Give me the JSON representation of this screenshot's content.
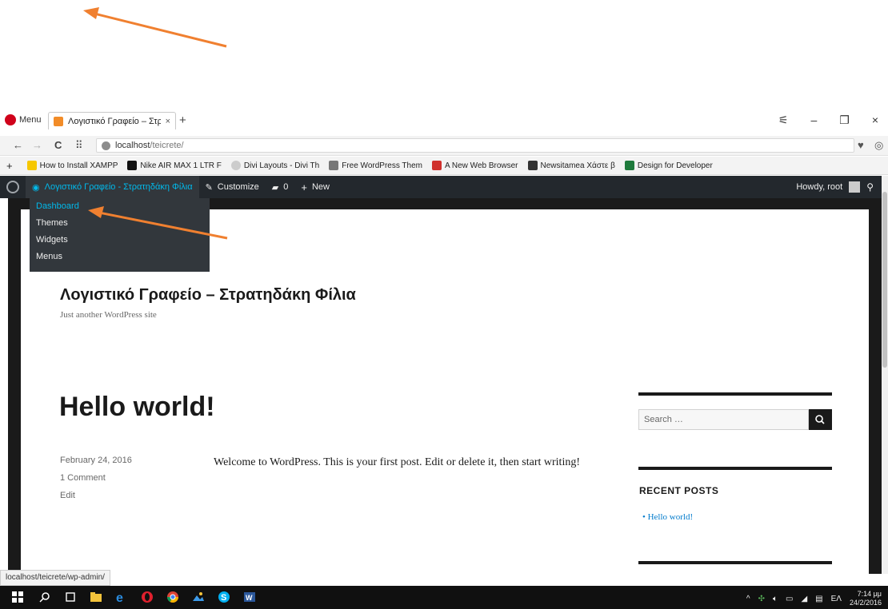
{
  "browser": {
    "menu_label": "Menu",
    "tab_title": "Λογιστικό Γραφείο – Στρα",
    "tab_close": "×",
    "new_tab": "+",
    "url_host": "localhost",
    "url_path": "/teicrete/",
    "window_controls": [
      "⚟",
      "–",
      "❐",
      "×"
    ]
  },
  "bookmarks": [
    {
      "label": "How to Install XAMPP",
      "color": "#f6c700"
    },
    {
      "label": "Nike AIR MAX 1 LTR F",
      "color": "#111111"
    },
    {
      "label": "Divi Layouts - Divi Th",
      "color": "#cccccc"
    },
    {
      "label": "Free WordPress Them",
      "color": "#777777"
    },
    {
      "label": "A New Web Browser",
      "color": "#d0312d"
    },
    {
      "label": "Newsitamea Χάστε β",
      "color": "#333333"
    },
    {
      "label": "Design for Developer",
      "color": "#1e7a3c"
    }
  ],
  "adminbar": {
    "site_name": "Λογιστικό Γραφείο - Στρατηδάκη Φίλια",
    "customize": "Customize",
    "comments_count": "0",
    "new": "New",
    "howdy": "Howdy, root"
  },
  "dropdown": {
    "items": [
      "Dashboard",
      "Themes",
      "Widgets",
      "Menus"
    ]
  },
  "site": {
    "title": "Λογιστικό Γραφείο – Στρατηδάκη Φίλια",
    "description": "Just another WordPress site"
  },
  "post": {
    "title": "Hello world!",
    "date": "February 24, 2016",
    "comments": "1 Comment",
    "edit": "Edit",
    "body": "Welcome to WordPress. This is your first post. Edit or delete it, then start writing!"
  },
  "sidebar": {
    "search_placeholder": "Search …",
    "recent_posts_title": "RECENT POSTS",
    "recent_posts": [
      "Hello world!"
    ]
  },
  "status_url": "localhost/teicrete/wp-admin/",
  "taskbar": {
    "lang": "ΕΛ",
    "time": "7:14 μμ",
    "date": "24/2/2016"
  },
  "colors": {
    "annotation_arrow": "#f08030",
    "adminbar_bg": "#23282d",
    "link_blue": "#00b9eb"
  }
}
